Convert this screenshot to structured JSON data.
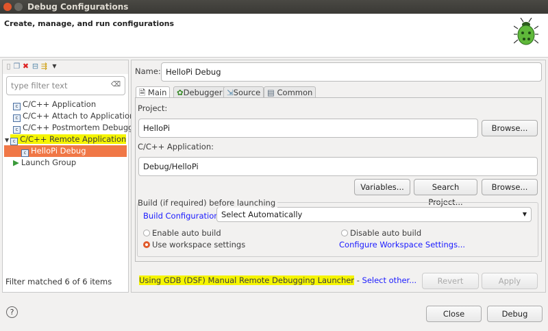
{
  "window": {
    "title": "Debug Configurations"
  },
  "header": {
    "subtitle": "Create, manage, and run configurations"
  },
  "left": {
    "filter_placeholder": "type filter text",
    "tree": [
      {
        "label": "C/C++ Application"
      },
      {
        "label": "C/C++ Attach to Application"
      },
      {
        "label": "C/C++ Postmortem Debugger"
      },
      {
        "label": "C/C++ Remote Application",
        "expanded": true
      },
      {
        "label": "HelloPi Debug",
        "selected": true
      },
      {
        "label": "Launch Group"
      }
    ],
    "filter_status": "Filter matched 6 of 6 items"
  },
  "right": {
    "name_label": "Name:",
    "name_value": "HelloPi Debug",
    "tabs": [
      {
        "label": "Main"
      },
      {
        "label": "Debugger"
      },
      {
        "label": "Source"
      },
      {
        "label": "Common"
      }
    ],
    "project_label": "Project:",
    "project_value": "HelloPi",
    "browse": "Browse...",
    "app_label": "C/C++ Application:",
    "app_value": "Debug/HelloPi",
    "variables": "Variables...",
    "search_project": "Search Project...",
    "build_group": "Build (if required) before launching",
    "build_config_label": "Build Configuration:",
    "build_config_value": "Select Automatically",
    "enable_auto": "Enable auto build",
    "disable_auto": "Disable auto build",
    "use_workspace": "Use workspace settings",
    "configure_ws": "Configure Workspace Settings...",
    "launcher_text": "Using GDB (DSF) Manual Remote Debugging Launcher",
    "launcher_sep": " - ",
    "select_other": "Select other...",
    "revert": "Revert",
    "apply": "Apply"
  },
  "footer": {
    "help": "?",
    "close": "Close",
    "debug": "Debug"
  }
}
